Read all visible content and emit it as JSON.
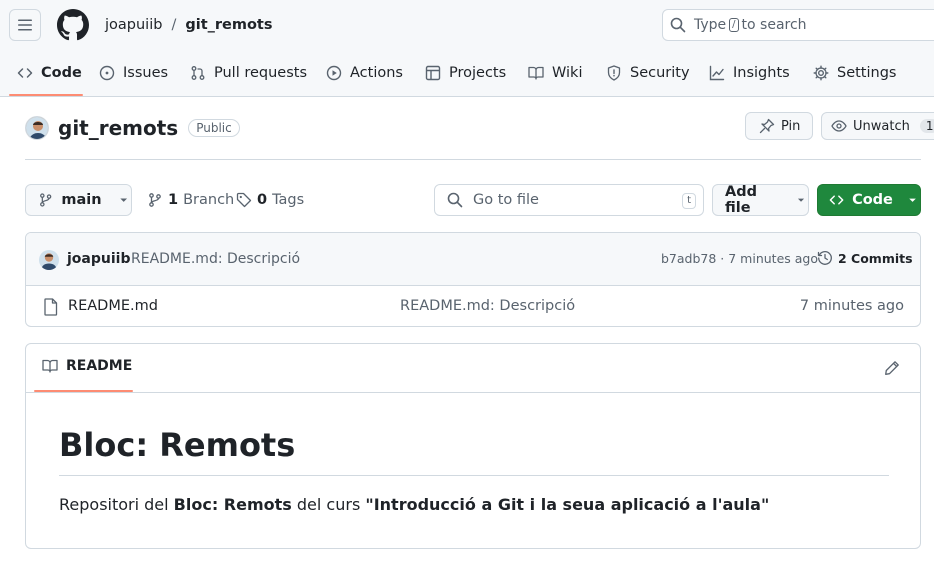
{
  "header": {
    "owner": "joapuiib",
    "separator": "/",
    "repo": "git_remots",
    "search": {
      "prefix": "Type",
      "key": "/",
      "suffix": "to search"
    }
  },
  "tabs": [
    {
      "label": "Code",
      "icon": "code-icon",
      "active": true
    },
    {
      "label": "Issues",
      "icon": "issue-icon"
    },
    {
      "label": "Pull requests",
      "icon": "pull-request-icon"
    },
    {
      "label": "Actions",
      "icon": "play-icon"
    },
    {
      "label": "Projects",
      "icon": "table-icon"
    },
    {
      "label": "Wiki",
      "icon": "book-icon"
    },
    {
      "label": "Security",
      "icon": "shield-icon"
    },
    {
      "label": "Insights",
      "icon": "graph-icon"
    },
    {
      "label": "Settings",
      "icon": "gear-icon"
    }
  ],
  "repo": {
    "name": "git_remots",
    "visibility": "Public",
    "pin_label": "Pin",
    "watch_label": "Unwatch",
    "watch_count": "1"
  },
  "toolbar": {
    "branch": "main",
    "branches_count": "1",
    "branches_label": "Branch",
    "tags_count": "0",
    "tags_label": "Tags",
    "goto_placeholder": "Go to file",
    "goto_key": "t",
    "add_file_label": "Add file",
    "code_label": "Code"
  },
  "commit": {
    "author": "joapuiib",
    "message": "README.md: Descripció",
    "sha_time": "b7adb78 · 7 minutes ago",
    "commits_label": "2 Commits"
  },
  "files": [
    {
      "name": "README.md",
      "message": "README.md: Descripció",
      "date": "7 minutes ago"
    }
  ],
  "readme": {
    "tab_label": "README",
    "title": "Bloc: Remots",
    "p_prefix": "Repositori del ",
    "p_bold1": "Bloc: Remots",
    "p_middle": " del curs ",
    "p_bold2": "\"Introducció a Git i la seua aplicació a l'aula\""
  },
  "colors": {
    "accent_underline": "#fd8c73",
    "primary_button": "#1f883d",
    "header_bg": "#f6f8fa",
    "border": "#d1d9e0"
  }
}
